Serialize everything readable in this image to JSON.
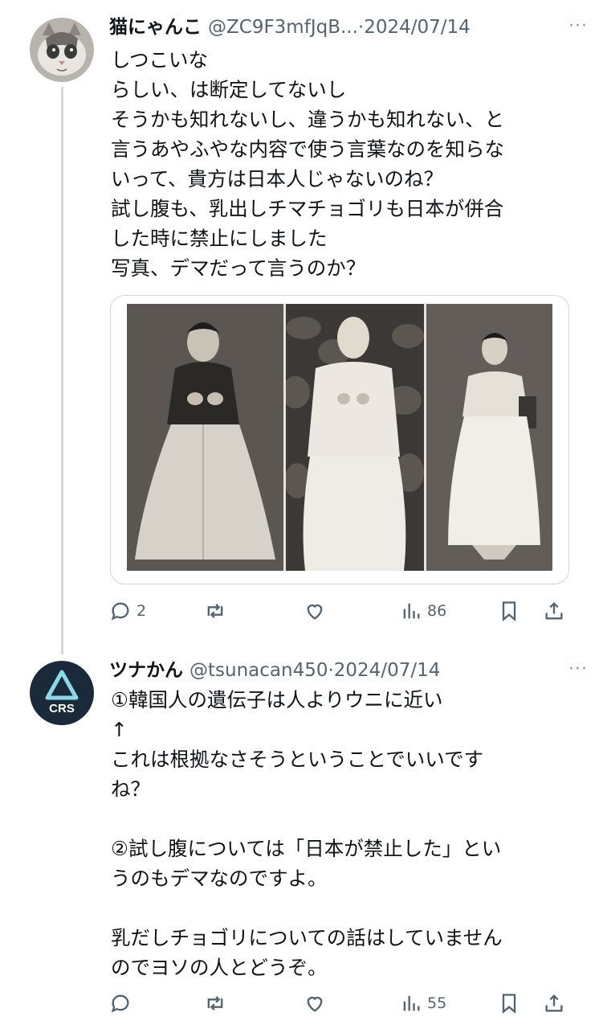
{
  "tweets": [
    {
      "name": "猫にゃんこ",
      "handle": "@ZC9F3mfJqB...",
      "dot": "·",
      "date": "2024/07/14",
      "more": "···",
      "lines": [
        "しつこいな",
        "らしい、は断定してないし",
        "そうかも知れないし、違うかも知れない、と",
        "言うあやふやな内容で使う言葉なのを知らな",
        "いって、貴方は日本人じゃないのね？",
        "試し腹も、乳出しチマチョゴリも日本が併合",
        "した時に禁止にしました",
        "写真、デマだって言うのか？"
      ],
      "image_icon": "photo-of-three-women-in-hanbok",
      "replies": "2",
      "retweets": "",
      "likes": "",
      "views": "86"
    },
    {
      "name": "ツナかん",
      "handle": "@tsunacan450",
      "dot": "·",
      "date": "2024/07/14",
      "more": "···",
      "avatar_text": "CRS",
      "lines": [
        "①韓国人の遺伝子は人よりウニに近い",
        "↑",
        "これは根拠なさそうということでいいです",
        "ね？",
        "",
        "②試し腹については「日本が禁止した」とい",
        "うのもデマなのですよ。",
        "",
        "乳だしチョゴリについての話はしていません",
        "のでヨソの人とどうぞ。"
      ],
      "replies": "",
      "retweets": "",
      "likes": "",
      "views": "55"
    }
  ],
  "colors": {
    "text": "#0f1419",
    "muted": "#536471",
    "border": "#cfd9de",
    "avatar2_bg": "#1b2a3a",
    "avatar2_accent": "#8ad8e8"
  }
}
